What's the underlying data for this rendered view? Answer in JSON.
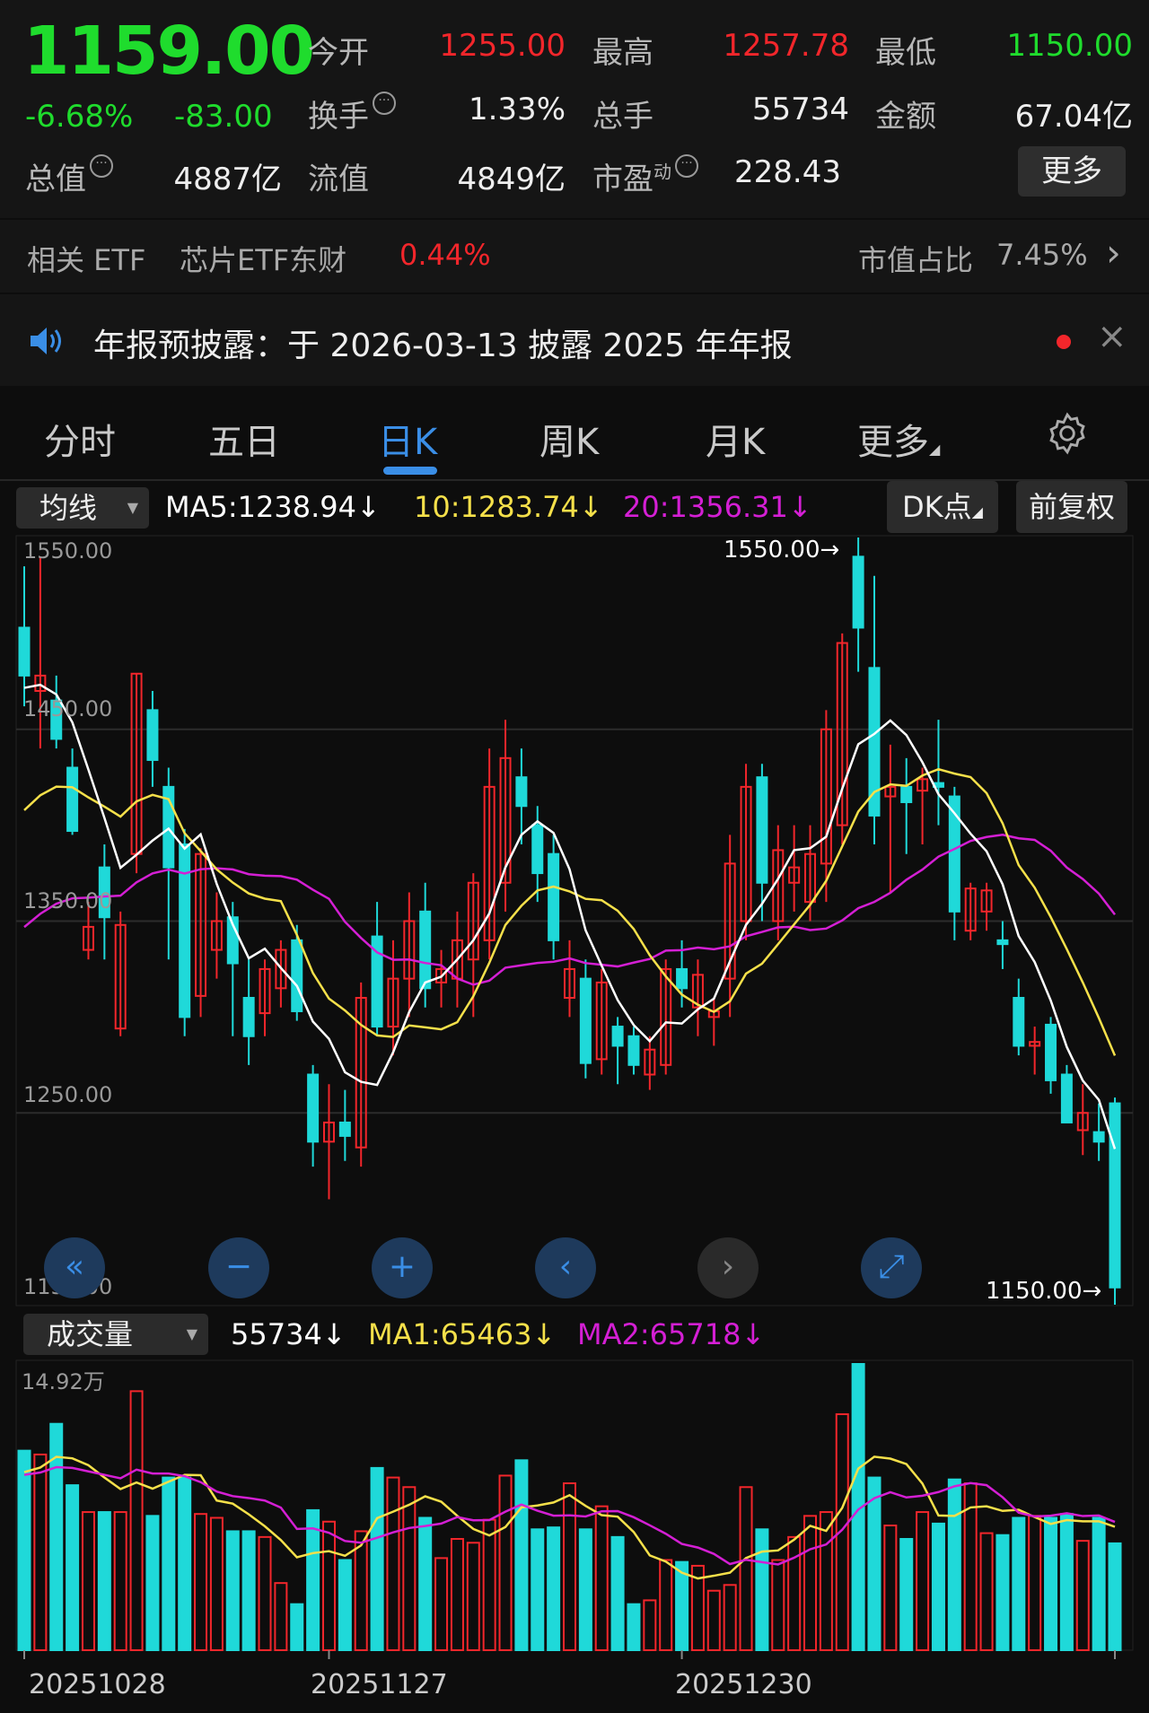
{
  "quote": {
    "price": "1159.00",
    "change_pct": "-6.68%",
    "change": "-83.00",
    "open_label": "今开",
    "open": "1255.00",
    "high_label": "最高",
    "high": "1257.78",
    "low_label": "最低",
    "low": "1150.00",
    "turnover_label": "换手",
    "turnover": "1.33%",
    "volume_label": "总手",
    "volume": "55734",
    "amount_label": "金额",
    "amount": "67.04亿",
    "mktcap_label": "总值",
    "mktcap": "4887亿",
    "float_label": "流值",
    "float": "4849亿",
    "pe_label": "市盈",
    "pe_sup": "动",
    "pe": "228.43",
    "more": "更多",
    "info_icon": "···"
  },
  "etf": {
    "label": "相关 ETF",
    "name": "芯片ETF东财",
    "change": "0.44%",
    "ratio_label": "市值占比",
    "ratio": "7.45%",
    "chevron": "›"
  },
  "announcement": {
    "text": "年报预披露：于 2026-03-13 披露 2025 年年报",
    "close": "×"
  },
  "tabs": [
    {
      "label": "分时"
    },
    {
      "label": "五日"
    },
    {
      "label": "日K"
    },
    {
      "label": "周K"
    },
    {
      "label": "月K"
    },
    {
      "label": "更多"
    }
  ],
  "toolbar": {
    "indicator": "均线",
    "ma5": "MA5:1238.94↓",
    "ma10": "10:1283.74↓",
    "ma20": "20:1356.31↓",
    "dk": "DK点",
    "adjust": "前复权"
  },
  "vol_toolbar": {
    "indicator": "成交量",
    "vol": "55734↓",
    "ma1": "MA1:65463↓",
    "ma2": "MA2:65718↓"
  },
  "colors": {
    "up": "#f2262b",
    "down": "#1fd9d9",
    "ma5": "#ffffff",
    "ma10": "#f5e04a",
    "ma20": "#d41fd4",
    "accent": "#3a8ee6"
  },
  "chart_data": {
    "type": "candlestick",
    "y_ticks": [
      "1550.00",
      "1450.00",
      "1350.00",
      "1250.00",
      "1150.00"
    ],
    "ylim": [
      1150,
      1550
    ],
    "max_label": "1550.00→",
    "min_label": "1150.00→",
    "x_labels": [
      "20251028",
      "20251127",
      "20251230"
    ],
    "candles": [
      [
        1503,
        1478,
        1535,
        1462
      ],
      [
        1470,
        1478,
        1540,
        1440
      ],
      [
        1465,
        1445,
        1478,
        1440
      ],
      [
        1430,
        1397,
        1440,
        1395
      ],
      [
        1335,
        1347,
        1360,
        1330
      ],
      [
        1378,
        1352,
        1390,
        1330
      ],
      [
        1294,
        1348,
        1355,
        1290
      ],
      [
        1385,
        1479,
        1479,
        1375
      ],
      [
        1460,
        1434,
        1470,
        1420
      ],
      [
        1420,
        1378,
        1430,
        1330
      ],
      [
        1390,
        1300,
        1398,
        1290
      ],
      [
        1311,
        1385,
        1388,
        1300
      ],
      [
        1335,
        1350,
        1365,
        1320
      ],
      [
        1352,
        1328,
        1360,
        1290
      ],
      [
        1310,
        1290,
        1330,
        1275
      ],
      [
        1302,
        1325,
        1330,
        1290
      ],
      [
        1315,
        1335,
        1340,
        1305
      ],
      [
        1340,
        1303,
        1348,
        1298
      ],
      [
        1270,
        1235,
        1275,
        1222
      ],
      [
        1235,
        1245,
        1265,
        1205
      ],
      [
        1245,
        1238,
        1262,
        1225
      ],
      [
        1232,
        1310,
        1318,
        1222
      ],
      [
        1342,
        1295,
        1360,
        1290
      ],
      [
        1295,
        1320,
        1340,
        1280
      ],
      [
        1320,
        1350,
        1365,
        1300
      ],
      [
        1355,
        1315,
        1370,
        1305
      ],
      [
        1318,
        1325,
        1335,
        1305
      ],
      [
        1320,
        1340,
        1355,
        1305
      ],
      [
        1330,
        1370,
        1375,
        1300
      ],
      [
        1340,
        1420,
        1440,
        1330
      ],
      [
        1370,
        1435,
        1455,
        1355
      ],
      [
        1425,
        1410,
        1440,
        1390
      ],
      [
        1400,
        1375,
        1410,
        1360
      ],
      [
        1385,
        1340,
        1395,
        1330
      ],
      [
        1310,
        1325,
        1340,
        1300
      ],
      [
        1320,
        1276,
        1330,
        1268
      ],
      [
        1278,
        1318,
        1325,
        1270
      ],
      [
        1295,
        1285,
        1300,
        1265
      ],
      [
        1290,
        1275,
        1295,
        1270
      ],
      [
        1270,
        1283,
        1290,
        1262
      ],
      [
        1275,
        1325,
        1330,
        1270
      ],
      [
        1325,
        1315,
        1340,
        1305
      ],
      [
        1305,
        1322,
        1330,
        1290
      ],
      [
        1300,
        1303,
        1310,
        1285
      ],
      [
        1320,
        1380,
        1395,
        1300
      ],
      [
        1350,
        1420,
        1432,
        1340
      ],
      [
        1425,
        1370,
        1432,
        1350
      ],
      [
        1350,
        1387,
        1400,
        1340
      ],
      [
        1370,
        1378,
        1400,
        1355
      ],
      [
        1360,
        1385,
        1400,
        1350
      ],
      [
        1380,
        1450,
        1460,
        1360
      ],
      [
        1400,
        1495,
        1500,
        1390
      ],
      [
        1540,
        1503,
        1550,
        1480
      ],
      [
        1482,
        1405,
        1530,
        1390
      ],
      [
        1415,
        1420,
        1442,
        1365
      ],
      [
        1420,
        1412,
        1435,
        1385
      ],
      [
        1418,
        1424,
        1430,
        1390
      ],
      [
        1422,
        1420,
        1455,
        1400
      ],
      [
        1415,
        1355,
        1420,
        1340
      ],
      [
        1345,
        1367,
        1370,
        1340
      ],
      [
        1355,
        1366,
        1370,
        1345
      ],
      [
        1340,
        1338,
        1350,
        1325
      ],
      [
        1310,
        1285,
        1320,
        1280
      ],
      [
        1285,
        1287,
        1295,
        1270
      ],
      [
        1296,
        1267,
        1300,
        1260
      ],
      [
        1270,
        1245,
        1275,
        1245
      ],
      [
        1241,
        1250,
        1265,
        1228
      ],
      [
        1240,
        1235,
        1255,
        1225
      ],
      [
        1255,
        1159,
        1258,
        1150
      ]
    ],
    "volume_max_label": "14.92万",
    "volumes_wan": [
      10.4,
      10.2,
      11.8,
      8.6,
      7.2,
      7.2,
      7.2,
      13.5,
      7.0,
      9.0,
      9.0,
      7.1,
      6.9,
      6.2,
      6.2,
      5.9,
      3.5,
      2.4,
      7.3,
      6.7,
      4.7,
      6.2,
      9.5,
      9.0,
      8.5,
      6.9,
      4.8,
      5.8,
      5.6,
      6.8,
      9.1,
      9.9,
      6.3,
      6.4,
      8.7,
      6.3,
      7.5,
      5.9,
      2.4,
      2.6,
      4.7,
      4.6,
      4.4,
      3.1,
      3.4,
      8.5,
      6.3,
      4.7,
      5.9,
      7.0,
      7.2,
      12.3,
      14.92,
      9.0,
      6.5,
      5.8,
      7.2,
      6.6,
      8.9,
      8.7,
      6.1,
      6.0,
      6.9,
      7.0,
      6.9,
      7.1,
      5.7,
      6.9,
      5.57
    ]
  },
  "controls": [
    {
      "icon": "«"
    },
    {
      "icon": "−"
    },
    {
      "icon": "+"
    },
    {
      "icon": "‹"
    },
    {
      "icon": "›"
    },
    {
      "icon": "⤢"
    }
  ]
}
